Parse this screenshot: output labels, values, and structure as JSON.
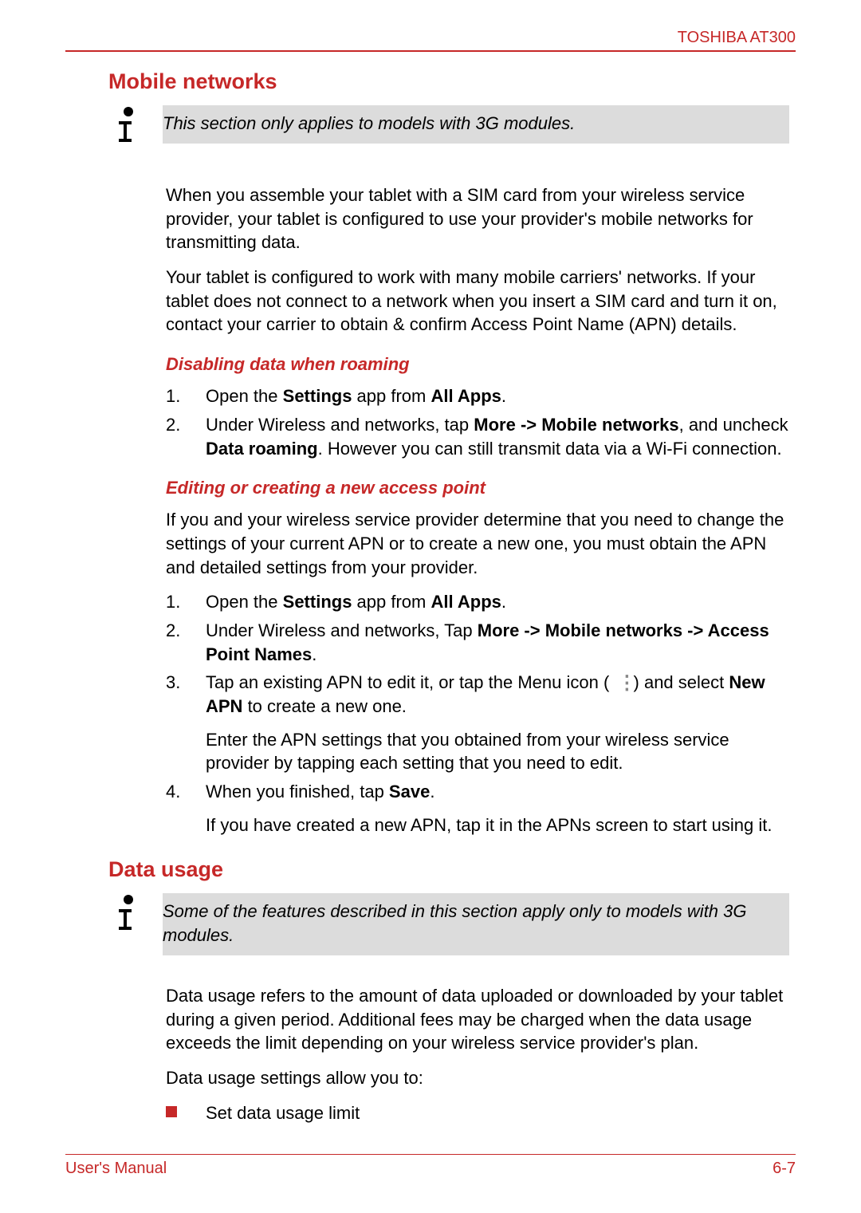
{
  "header": {
    "product": "TOSHIBA AT300"
  },
  "sections": {
    "mobile_networks": {
      "title": "Mobile networks",
      "note": "This section only applies to models with 3G modules.",
      "intro1": "When you assemble your tablet with a SIM card from your wireless service provider, your tablet is configured to use your provider's mobile networks for transmitting data.",
      "intro2": "Your tablet is configured to work with many mobile carriers' networks. If your tablet does not connect to a network when you insert a SIM card and turn it on, contact your carrier to obtain & confirm Access Point Name (APN) details.",
      "sub1": {
        "title": "Disabling data when roaming",
        "step1_a": "Open the ",
        "step1_b_bold": "Settings",
        "step1_c": " app from ",
        "step1_d_bold": "All Apps",
        "step1_e": ".",
        "step2_a": "Under Wireless and networks, tap ",
        "step2_b_bold": "More -> Mobile networks",
        "step2_c": ", and uncheck ",
        "step2_d_bold": "Data roaming",
        "step2_e": ". However you can still transmit data via a Wi-Fi connection."
      },
      "sub2": {
        "title": "Editing or creating a new access point",
        "intro": "If you and your wireless service provider determine that you need to change the settings of your current APN or to create a new one, you must obtain the APN and detailed settings from your provider.",
        "step1_a": "Open the ",
        "step1_b_bold": "Settings",
        "step1_c": " app from ",
        "step1_d_bold": "All Apps",
        "step1_e": ".",
        "step2_a": "Under Wireless and networks, Tap ",
        "step2_b_bold": "More -> Mobile networks -> Access Point Names",
        "step2_c": ".",
        "step3_a": "Tap an existing APN to edit it, or tap the Menu icon ( ",
        "step3_b": " ) and select ",
        "step3_c_bold": "New APN",
        "step3_d": " to create a new one.",
        "step3_extra": "Enter the APN settings that you obtained from your wireless service provider by tapping each setting that you need to edit.",
        "step4_a": "When you finished, tap ",
        "step4_b_bold": "Save",
        "step4_c": ".",
        "step4_extra": "If you have created a new APN, tap it in the APNs screen to start using it."
      }
    },
    "data_usage": {
      "title": "Data usage",
      "note": "Some of the features described in this section apply only to models with 3G modules.",
      "intro1": "Data usage refers to the amount of data uploaded or downloaded by your tablet during a given period. Additional fees may be charged when the data usage exceeds the limit depending on your wireless service provider's plan.",
      "intro2": "Data usage settings allow you to:",
      "bullet1": "Set data usage limit"
    }
  },
  "footer": {
    "left": "User's Manual",
    "right": "6-7"
  },
  "icons": {
    "info": "info-icon",
    "menu": "menu-dots-icon",
    "bullet": "red-square-bullet"
  }
}
